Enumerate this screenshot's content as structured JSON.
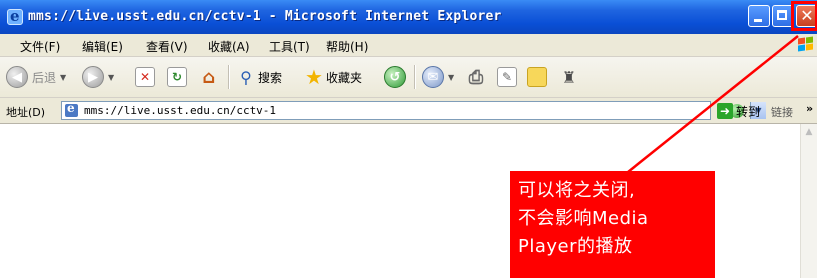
{
  "window": {
    "title": "mms://live.usst.edu.cn/cctv-1 - Microsoft Internet Explorer",
    "close_symbol": "✕"
  },
  "menubar": {
    "items": [
      "文件(F)",
      "编辑(E)",
      "查看(V)",
      "收藏(A)",
      "工具(T)",
      "帮助(H)"
    ]
  },
  "toolbar": {
    "back_label": "后退",
    "search_label": "搜索",
    "favorites_label": "收藏夹"
  },
  "addressbar": {
    "label": "地址(D)",
    "url": "mms://live.usst.edu.cn/cctv-1",
    "go_label": "转到",
    "links_label": "链接",
    "links_chevron": "»"
  },
  "annotation": {
    "lines": [
      "可以将之关闭,",
      "不会影响Media",
      "Player的播放"
    ],
    "color": "#ff0000"
  }
}
